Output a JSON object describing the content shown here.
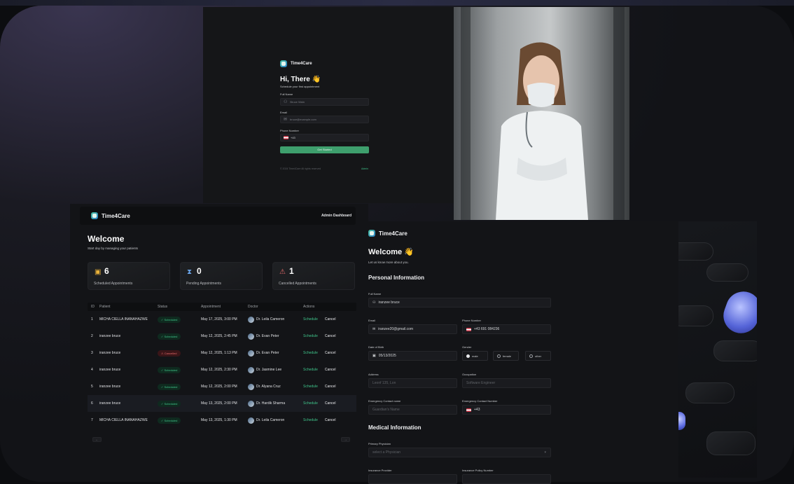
{
  "login": {
    "brand": "Time4Care",
    "greeting": "Hi, There 👋",
    "subtitle": "Schedule your first appointment",
    "full_name_label": "Full Name",
    "full_name_placeholder": "Bruce Wain",
    "email_label": "Email",
    "email_placeholder": "bruce@example.com",
    "phone_label": "Phone Number",
    "phone_value": "+43",
    "submit_label": "Get Started",
    "footer_left": "© 2024 Time4Care All rights reserved",
    "footer_right": "Admin"
  },
  "admin": {
    "brand": "Time4Care",
    "header_right": "Admin Dashboard",
    "title": "Welcome",
    "subtitle": "Start day by managing your patients",
    "stats": [
      {
        "count": "6",
        "label": "Scheduled Appointments",
        "icon": "calendar-icon",
        "color": "#e8b13a"
      },
      {
        "count": "0",
        "label": "Pending Appointments",
        "icon": "hourglass-icon",
        "color": "#6aa4e8"
      },
      {
        "count": "1",
        "label": "Cancelled Appointments",
        "icon": "warning-icon",
        "color": "#e46a6a"
      }
    ],
    "columns": [
      "ID",
      "Patient",
      "Status",
      "Appointment",
      "Doctor",
      "Actions"
    ],
    "rows": [
      {
        "id": "1",
        "patient": "MICHA CIELLA INANAHAZWE",
        "status": "Scheduled",
        "appointment": "May 17, 2025, 3:00 PM",
        "doctor": "Dr. Leila Cameron",
        "schedule": "Schedule",
        "cancel": "Cancel"
      },
      {
        "id": "2",
        "patient": "iranzee bruce",
        "status": "Scheduled",
        "appointment": "May 12, 2025, 2:45 PM",
        "doctor": "Dr. Evan Peter",
        "schedule": "Schedule",
        "cancel": "Cancel"
      },
      {
        "id": "3",
        "patient": "iranzee bruce",
        "status": "Cancelled",
        "appointment": "May 12, 2025, 1:13 PM",
        "doctor": "Dr. Evan Peter",
        "schedule": "Schedule",
        "cancel": "Cancel"
      },
      {
        "id": "4",
        "patient": "iranzee bruce",
        "status": "Scheduled",
        "appointment": "May 12, 2025, 2:30 PM",
        "doctor": "Dr. Jasmine Lee",
        "schedule": "Schedule",
        "cancel": "Cancel"
      },
      {
        "id": "5",
        "patient": "iranzee bruce",
        "status": "Scheduled",
        "appointment": "May 12, 2025, 2:00 PM",
        "doctor": "Dr. Alyana Cruz",
        "schedule": "Schedule",
        "cancel": "Cancel"
      },
      {
        "id": "6",
        "patient": "iranzee bruce",
        "status": "Scheduled",
        "appointment": "May 13, 2025, 2:00 PM",
        "doctor": "Dr. Hardik Sharma",
        "schedule": "Schedule",
        "cancel": "Cancel"
      },
      {
        "id": "7",
        "patient": "MICHA CIELLA INANAHAZWE",
        "status": "Scheduled",
        "appointment": "May 13, 2025, 1:30 PM",
        "doctor": "Dr. Leila Cameron",
        "schedule": "Schedule",
        "cancel": "Cancel"
      }
    ],
    "prev_label": "←",
    "next_label": "→"
  },
  "register": {
    "brand": "Time4Care",
    "title": "Welcome 👋",
    "subtitle": "Let us know more about you.",
    "personal_heading": "Personal Information",
    "full_name_label": "Full Name",
    "full_name_value": "iranzee bruce",
    "email_label": "Email",
    "email_value": "iranzee20@gmail.com",
    "phone_label": "Phone Number",
    "phone_value": "+43 691 084236",
    "dob_label": "Date of Birth",
    "dob_value": "05/13/2025",
    "gender_label": "Gender",
    "gender_options": [
      "male",
      "female",
      "other"
    ],
    "address_label": "Address",
    "address_placeholder": "Leonf 135, Lon",
    "occupation_label": "Occupation",
    "occupation_placeholder": "Software Engineer",
    "emergency_name_label": "Emergency Contact name",
    "emergency_name_placeholder": "Guardian's Name",
    "emergency_number_label": "Emergency Contact Number",
    "emergency_number_value": "+43",
    "medical_heading": "Medical Information",
    "physician_label": "Primary Physician",
    "physician_placeholder": "select a Physician",
    "insurance_provider_label": "Insurance Provider",
    "insurance_number_label": "Insurance Policy Number"
  },
  "colors": {
    "accent": "#3fc48a",
    "danger": "#e46a6a",
    "button": "#3e9f6d"
  }
}
